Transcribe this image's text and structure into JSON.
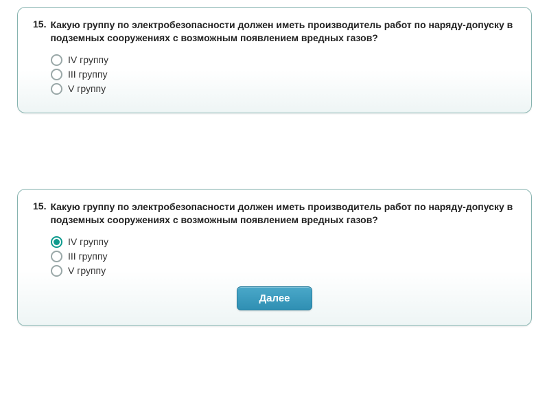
{
  "question": {
    "number": "15.",
    "text": "Какую группу по электробезопасности должен иметь производитель работ по наряду-допуску в подземных сооружениях с возможным появлением вредных газов?",
    "options": [
      "IV группу",
      "III группу",
      "V группу"
    ]
  },
  "card2_selected_index": 0,
  "next_button": "Далее"
}
